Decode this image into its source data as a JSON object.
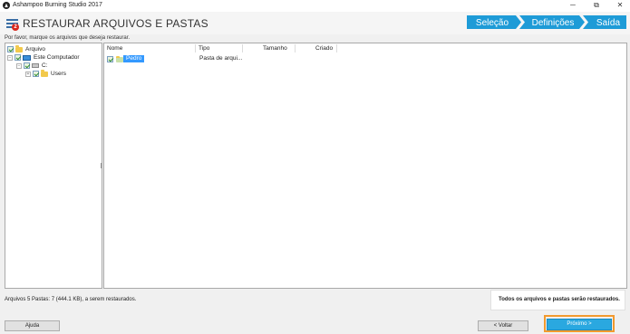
{
  "window": {
    "title": "Ashampoo Burning Studio 2017",
    "controls": {
      "minimize": "─",
      "restore": "⧉",
      "close": "✕"
    }
  },
  "header": {
    "title": "RESTAURAR ARQUIVOS E PASTAS",
    "badge_count": "2",
    "steps": [
      "Seleção",
      "Definições",
      "Saída"
    ],
    "step_color": "#1e9bd7"
  },
  "instruction": "Por favor, marque os arquivos que deseja restaurar.",
  "tree": {
    "items": [
      {
        "label": "Arquivo",
        "icon": "folder-icon"
      },
      {
        "label": "Este Computador",
        "icon": "computer-icon"
      },
      {
        "label": "C:",
        "icon": "drive-icon"
      },
      {
        "label": "Users",
        "icon": "folder-icon"
      }
    ]
  },
  "list": {
    "columns": [
      "Nome",
      "Tipo",
      "Tamanho",
      "Criado"
    ],
    "rows": [
      {
        "name": "Pedro",
        "type": "Pasta de arqui...",
        "size": "",
        "created": ""
      }
    ]
  },
  "status": {
    "summary": "Arquivos 5 Pastas: 7 (444.1 KB), a serem restaurados.",
    "message": "Todos os arquivos e pastas serão restaurados."
  },
  "buttons": {
    "help": "Ajuda",
    "back": "< Voltar",
    "next": "Próximo >"
  },
  "colors": {
    "accent": "#2aa8e0",
    "focus": "#f29a2e",
    "badge": "#d9261c"
  }
}
